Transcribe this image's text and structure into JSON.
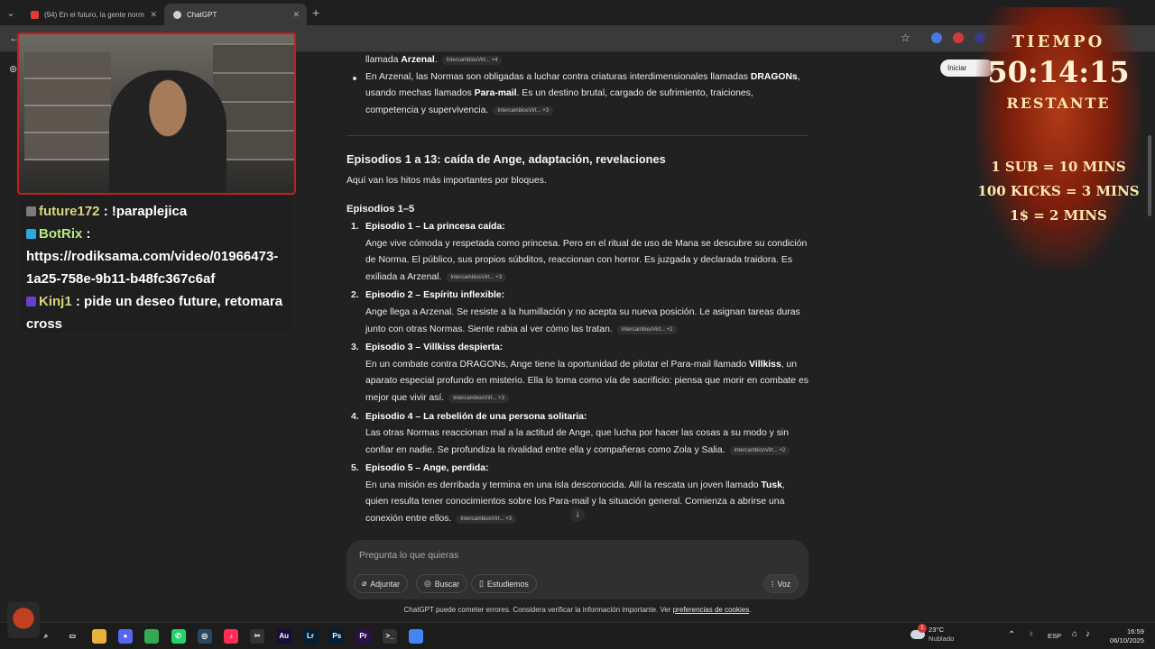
{
  "browser": {
    "tabs": [
      {
        "title": "(94) En el futuro, la gente norm",
        "favicon_color": "#e53935"
      },
      {
        "title": "ChatGPT",
        "favicon_color": "#d0d0d0"
      }
    ]
  },
  "chatgpt": {
    "start_button": "Iniciar",
    "intro_bullets": [
      {
        "segments": [
          {
            "t": "llamada "
          },
          {
            "t": "Arzenal",
            "b": true
          },
          {
            "t": "."
          }
        ],
        "chip": "IntercambiosVirt... +4"
      },
      {
        "segments": [
          {
            "t": "En Arzenal, las Normas son obligadas a luchar contra criaturas interdimensionales llamadas "
          },
          {
            "t": "DRAGONs",
            "b": true
          },
          {
            "t": ", usando mechas llamados "
          },
          {
            "t": "Para-mail",
            "b": true
          },
          {
            "t": ". Es un destino brutal, cargado de sufrimiento, traiciones, competencia y supervivencia."
          }
        ],
        "chip": "IntercambiosVirt... +3"
      }
    ],
    "section_heading": "Episodios 1 a 13: caída de Ange, adaptación, revelaciones",
    "section_intro": "Aquí van los hitos más importantes por bloques.",
    "block_heading": "Episodios 1–5",
    "episodes": [
      {
        "num": "1.",
        "title": "Episodio 1 – La princesa caída:",
        "segments": [
          {
            "t": "Ange vive cómoda y respetada como princesa. Pero en el ritual de uso de Mana se descubre su condición de Norma. El público, sus propios súbditos, reaccionan con horror. Es juzgada y declarada traidora. Es exiliada a Arzenal."
          }
        ],
        "chip": "IntercambiosVirt... +3"
      },
      {
        "num": "2.",
        "title": "Episodio 2 – Espíritu inflexible:",
        "segments": [
          {
            "t": "Ange llega a Arzenal. Se resiste a la humillación y no acepta su nueva posición. Le asignan tareas duras junto con otras Normas. Siente rabia al ver cómo las tratan."
          }
        ],
        "chip": "IntercambiosVirt... +2"
      },
      {
        "num": "3.",
        "title": "Episodio 3 – Villkiss despierta:",
        "segments": [
          {
            "t": "En un combate contra DRAGONs, Ange tiene la oportunidad de pilotar el Para-mail llamado "
          },
          {
            "t": "Villkiss",
            "b": true
          },
          {
            "t": ", un aparato especial profundo en misterio. Ella lo toma como vía de sacrificio: piensa que morir en combate es mejor que vivir así."
          }
        ],
        "chip": "IntercambiosVirt... +3"
      },
      {
        "num": "4.",
        "title": "Episodio 4 – La rebelión de una persona solitaria:",
        "segments": [
          {
            "t": "Las otras Normas reaccionan mal a la actitud de Ange, que lucha por hacer las cosas a su modo y sin confiar en nadie. Se profundiza la rivalidad entre ella y compañeras como Zola y Salia."
          }
        ],
        "chip": "IntercambiosVirt... +2"
      },
      {
        "num": "5.",
        "title": "Episodio 5 – Ange, perdida:",
        "segments": [
          {
            "t": "En una misión es derribada y termina en una isla desconocida. Allí la rescata un joven llamado "
          },
          {
            "t": "Tusk",
            "b": true
          },
          {
            "t": ", quien resulta tener conocimientos sobre los Para-mail y la situación general. Comienza a abrirse una conexión entre ellos."
          }
        ],
        "chip": "IntercambiosVirt... +3"
      }
    ],
    "composer": {
      "placeholder": "Pregunta lo que quieras",
      "attach": "Adjuntar",
      "search": "Buscar",
      "study": "Estudiemos",
      "voice": "Voz"
    },
    "disclaimer_prefix": "ChatGPT puede cometer errores. Considera verificar la información importante. Ver ",
    "disclaimer_link": "preferencias de cookies",
    "disclaimer_suffix": "."
  },
  "stream_chat": [
    {
      "user": "future172",
      "sep": " : ",
      "msg": "!paraplejica",
      "user_color": "#d8d67a",
      "badge_color": "#7b7b7b"
    },
    {
      "user": "BotRix",
      "sep": " :",
      "msg": "https://rodiksama.com/video/01966473-1a25-758e-9b11-b48fc367c6af",
      "user_color": "#b8e986",
      "badge_color": "#2aa8e0"
    },
    {
      "user": "Kinj1",
      "sep": " : ",
      "msg": "pide un deseo future, retomara cross",
      "user_color": "#d8d67a",
      "badge_color": "#6a3fc9"
    }
  ],
  "timer_overlay": {
    "label_top": "TIEMPO",
    "time": "50:14:15",
    "label_bottom": "RESTANTE",
    "rules": [
      "1 SUB = 10 MINS",
      "100 KICKS = 3 MINS",
      "1$ = 2 MINS"
    ]
  },
  "taskbar": {
    "weather_temp": "23°C",
    "weather_desc": "Nublado",
    "weather_badge": "1",
    "language": "ESP",
    "time": "16:59",
    "date": "06/10/2025",
    "app_icons": [
      {
        "name": "search-icon",
        "label": "⌕",
        "color": "#1c1c1c"
      },
      {
        "name": "task-view-icon",
        "label": "▭",
        "color": "#1c1c1c"
      },
      {
        "name": "file-explorer-icon",
        "label": "",
        "color": "#e8b13a"
      },
      {
        "name": "discord-icon",
        "label": "●",
        "color": "#5865f2"
      },
      {
        "name": "chrome-icon",
        "label": "",
        "color": "#34a853"
      },
      {
        "name": "whatsapp-icon",
        "label": "✆",
        "color": "#25d366"
      },
      {
        "name": "steam-icon",
        "label": "◎",
        "color": "#2a475e"
      },
      {
        "name": "tiktok-icon",
        "label": "♪",
        "color": "#ff2d55"
      },
      {
        "name": "capcut-icon",
        "label": "✂",
        "color": "#333333"
      },
      {
        "name": "audition-icon",
        "label": "Au",
        "color": "#1a0c3a"
      },
      {
        "name": "lightroom-icon",
        "label": "Lr",
        "color": "#001e36"
      },
      {
        "name": "photoshop-icon",
        "label": "Ps",
        "color": "#001e36"
      },
      {
        "name": "premiere-icon",
        "label": "Pr",
        "color": "#2a0f4f"
      },
      {
        "name": "terminal-icon",
        "label": ">_",
        "color": "#333333"
      },
      {
        "name": "chrome-active-icon",
        "label": "",
        "color": "#4285f4"
      }
    ]
  }
}
